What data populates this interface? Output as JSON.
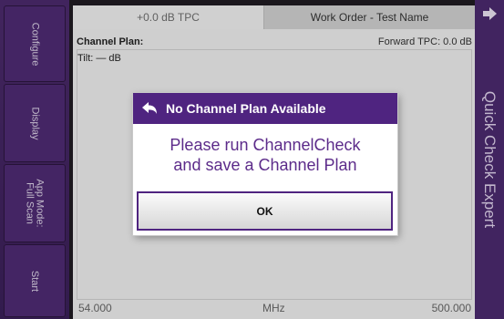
{
  "sidebar": {
    "buttons": [
      {
        "label": "Configure"
      },
      {
        "label": "Display"
      },
      {
        "label": "App Mode:\nFull Scan"
      },
      {
        "label": "Start"
      }
    ]
  },
  "tabs": {
    "tpc": "+0.0 dB TPC",
    "work_order": "Work Order - Test Name"
  },
  "panel": {
    "title": "Channel Plan:",
    "forward_tpc": "Forward TPC: 0.0 dB",
    "tilt": "Tilt: — dB"
  },
  "chart_data": {
    "type": "line",
    "xlabel": "MHz",
    "xlim": [
      54.0,
      500.0
    ],
    "x_ticks": [
      "54.000",
      "500.000"
    ],
    "series": []
  },
  "right_panel": {
    "title": "Quick Check Expert",
    "icon": "arrow-right-icon"
  },
  "dialog": {
    "title": "No Channel Plan Available",
    "message_line1": "Please run ChannelCheck",
    "message_line2": "and save a Channel Plan",
    "ok_label": "OK"
  },
  "colors": {
    "accent_purple": "#4f2480",
    "sidebar_purple": "#4e2b72",
    "message_purple": "#5c2b8a"
  }
}
